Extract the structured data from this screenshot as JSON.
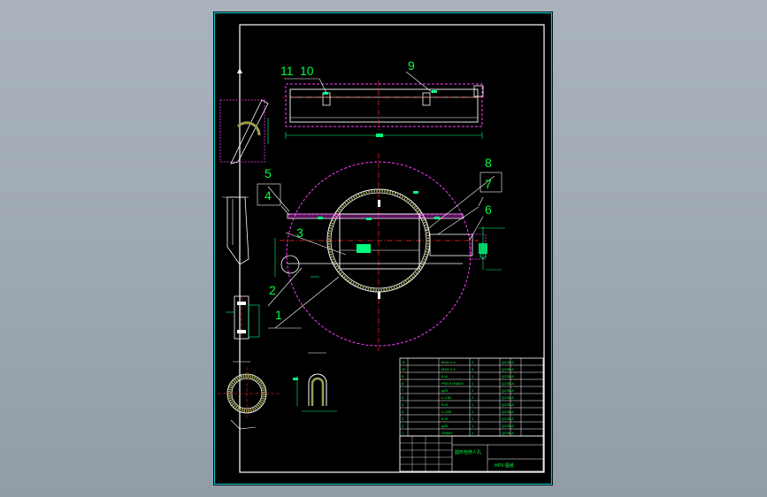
{
  "drawing": {
    "part_labels": [
      "11",
      "10",
      "9",
      "8",
      "7",
      "6",
      "5",
      "4",
      "3",
      "2",
      "1"
    ],
    "title_block": {
      "name_line": "圆形检修人孔",
      "drawing_no": "HPX-图纸"
    },
    "parts_table": {
      "rows": [
        {
          "no": "11",
          "spec": "M16×1.5",
          "qty": "4",
          "material": "Q235-A"
        },
        {
          "no": "10",
          "spec": "M16×1.5",
          "qty": "4",
          "material": "Q235-A"
        },
        {
          "no": "9",
          "spec": "δ=6",
          "qty": "1",
          "material": "Q235-A"
        },
        {
          "no": "8",
          "spec": "PN0.6 DN600",
          "qty": "1",
          "material": "Q235-A"
        },
        {
          "no": "7",
          "spec": "φ25",
          "qty": "1",
          "material": "Q235-A"
        },
        {
          "no": "6",
          "spec": "L=150",
          "qty": "2",
          "material": "Q235-A"
        },
        {
          "no": "5",
          "spec": "δ=8",
          "qty": "1",
          "material": "Q235-A"
        },
        {
          "no": "4",
          "spec": "L=200",
          "qty": "2",
          "material": "Q235-A"
        },
        {
          "no": "3",
          "spec": "δ=6",
          "qty": "1",
          "material": "Q235-A"
        },
        {
          "no": "2",
          "spec": "φ20",
          "qty": "1",
          "material": "Q235-A"
        },
        {
          "no": "1",
          "spec": "DN600",
          "qty": "1",
          "material": "Q235-A"
        }
      ]
    }
  },
  "colors": {
    "background": "#9ea8b2",
    "sheet": "#000000",
    "frame": "#ffffff",
    "outer_frame": "#00c8c8",
    "part_lines": "#ffffff",
    "center_lines": "#ff2b2b",
    "hidden_lines": "#ff3cff",
    "dimension": "#00ff80",
    "hatch": "#9d9d52",
    "labels": "#00ff40"
  }
}
